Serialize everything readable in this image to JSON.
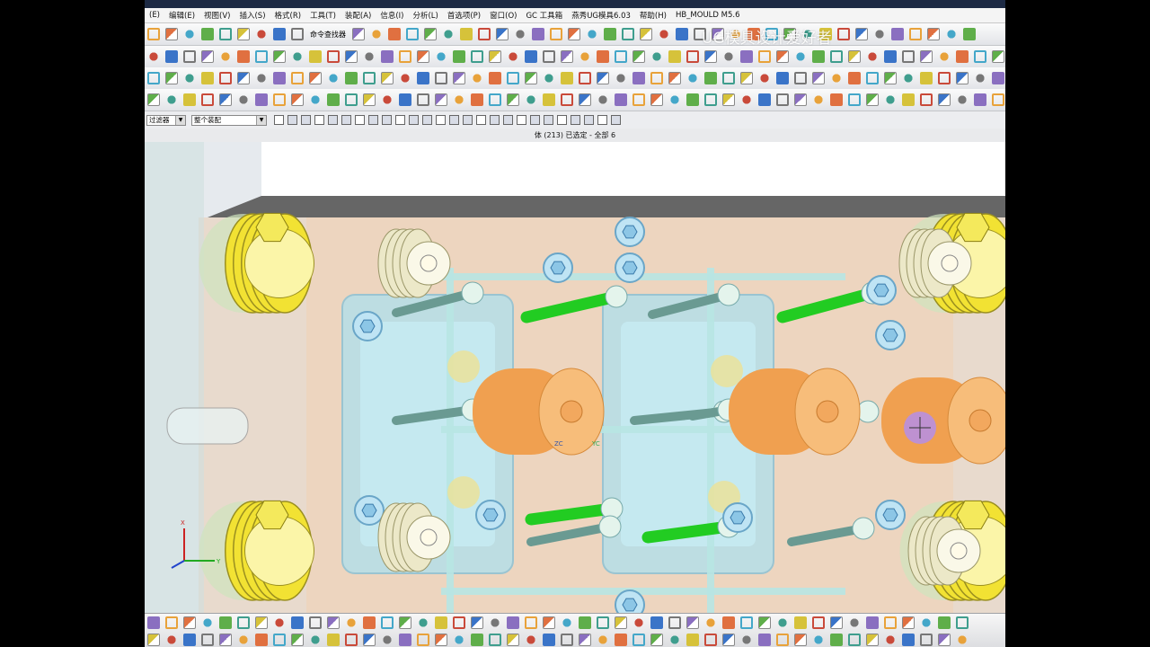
{
  "watermark": "UG模具设计爱好者",
  "menu": [
    "(E)",
    "编辑(E)",
    "视图(V)",
    "插入(S)",
    "格式(R)",
    "工具(T)",
    "装配(A)",
    "信息(I)",
    "分析(L)",
    "首选项(P)",
    "窗口(O)",
    "GC 工具箱",
    "燕秀UG模具6.03",
    "帮助(H)",
    "HB_MOULD M5.6"
  ],
  "command_finder": "命令查找器",
  "selection": {
    "filter": "过滤器",
    "scope": "整个装配"
  },
  "status_text": "体 (213) 已选定 - 全部 6",
  "axis": {
    "x": "X",
    "y": "Y",
    "zc": "ZC",
    "yc": "YC"
  },
  "colors": {
    "yellow": "#f2e233",
    "orange": "#f0a050",
    "green": "#22cc22",
    "cyan": "#aee0ee",
    "plate": "#e9ccb2"
  }
}
